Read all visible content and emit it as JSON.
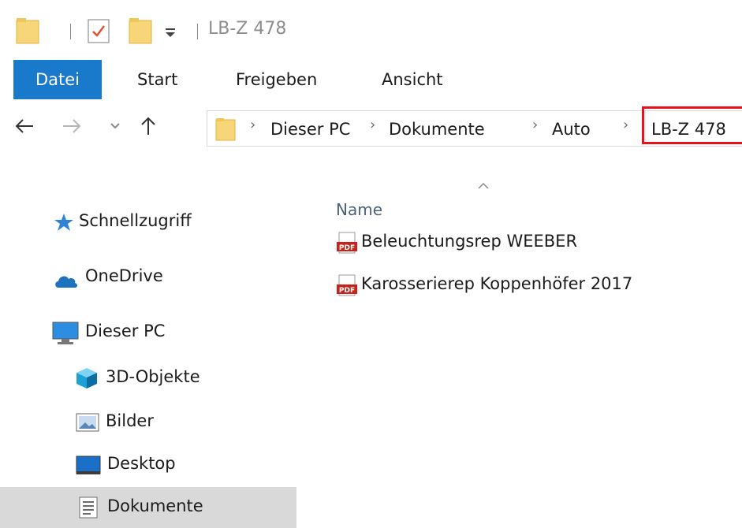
{
  "window": {
    "title": "LB-Z 478"
  },
  "quick_access_toolbar": {
    "icons": [
      "folder-icon",
      "properties-icon",
      "new-folder-icon",
      "customize-dropdown-icon"
    ]
  },
  "ribbon": {
    "tabs": [
      {
        "label": "Datei",
        "active": true
      },
      {
        "label": "Start"
      },
      {
        "label": "Freigeben"
      },
      {
        "label": "Ansicht"
      }
    ],
    "active_color": "#1979ca"
  },
  "navigation": {
    "back_icon": "arrow-left-icon",
    "forward_icon": "arrow-right-icon",
    "recent_icon": "chevron-down-icon",
    "up_icon": "arrow-up-icon",
    "breadcrumb": [
      {
        "label": "Dieser PC"
      },
      {
        "label": "Dokumente"
      },
      {
        "label": "Auto"
      },
      {
        "label": "LB-Z 478"
      }
    ],
    "highlight_color": "#e8121c"
  },
  "sidebar": {
    "items": [
      {
        "label": "Schnellzugriff",
        "icon": "star-icon"
      },
      {
        "label": "OneDrive",
        "icon": "cloud-icon"
      },
      {
        "label": "Dieser PC",
        "icon": "computer-icon"
      },
      {
        "label": "3D-Objekte",
        "icon": "cube-icon"
      },
      {
        "label": "Bilder",
        "icon": "pictures-icon"
      },
      {
        "label": "Desktop",
        "icon": "desktop-icon"
      },
      {
        "label": "Dokumente",
        "icon": "document-icon",
        "selected": true
      }
    ]
  },
  "file_list": {
    "column_name": "Name",
    "sort_icon": "sort-ascending-icon",
    "files": [
      {
        "name": "Beleuchtungsrep WEEBER",
        "icon": "pdf-icon",
        "icon_text": "PDF"
      },
      {
        "name": "Karosserierep Koppenhöfer 2017",
        "icon": "pdf-icon",
        "icon_text": "PDF"
      }
    ]
  }
}
